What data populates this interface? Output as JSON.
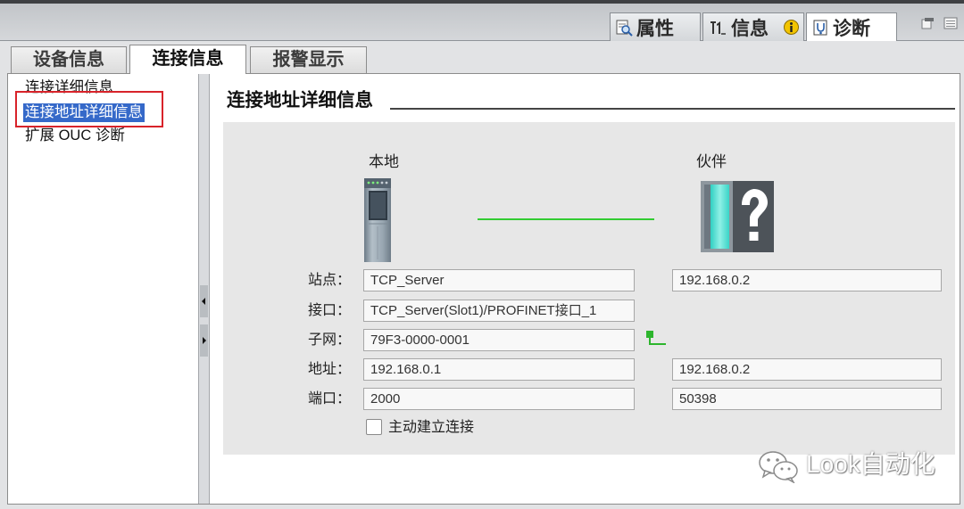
{
  "top_tabs": [
    {
      "label": "属性",
      "icon": "properties-icon",
      "active": false
    },
    {
      "label": "信息",
      "icon": "info-icon",
      "active": false
    },
    {
      "label": "诊断",
      "icon": "diagnostics-icon",
      "active": true
    }
  ],
  "info_badge_icon": "info-circle-icon",
  "window_controls": [
    "float-window-icon",
    "layout-menu-icon"
  ],
  "sub_tabs": [
    {
      "label": "设备信息",
      "active": false
    },
    {
      "label": "连接信息",
      "active": true
    },
    {
      "label": "报警显示",
      "active": false
    }
  ],
  "nav_items": [
    {
      "label": "连接详细信息",
      "selected": false
    },
    {
      "label": "连接地址详细信息",
      "selected": true
    },
    {
      "label": "扩展 OUC 诊断",
      "selected": false
    }
  ],
  "section_title": "连接地址详细信息",
  "local": {
    "heading": "本地",
    "device_icon": "plc-module-icon"
  },
  "partner": {
    "heading": "伙伴",
    "device_icon": "unknown-device-icon"
  },
  "link_icon": "connection-line",
  "subnet_icon": "subnet-icon",
  "fields": [
    {
      "label": "站点：",
      "local": "TCP_Server",
      "partner": "192.168.0.2"
    },
    {
      "label": "接口：",
      "local": "TCP_Server(Slot1)/PROFINET接口_1"
    },
    {
      "label": "子网：",
      "local": "79F3-0000-0001"
    },
    {
      "label": "地址：",
      "local": "192.168.0.1",
      "partner": "192.168.0.2"
    },
    {
      "label": "端口：",
      "local": "2000",
      "partner": "50398"
    }
  ],
  "active_connect": {
    "label": "主动建立连接",
    "checked": false
  },
  "watermark": {
    "text": "Look自动化",
    "icon": "wechat-icon"
  },
  "colors": {
    "selection": "#3569c9",
    "highlight_box": "#d8232a",
    "connection_line": "#33cc33",
    "subnet_icon": "#2db52d",
    "info_badge": "#f2c400"
  }
}
